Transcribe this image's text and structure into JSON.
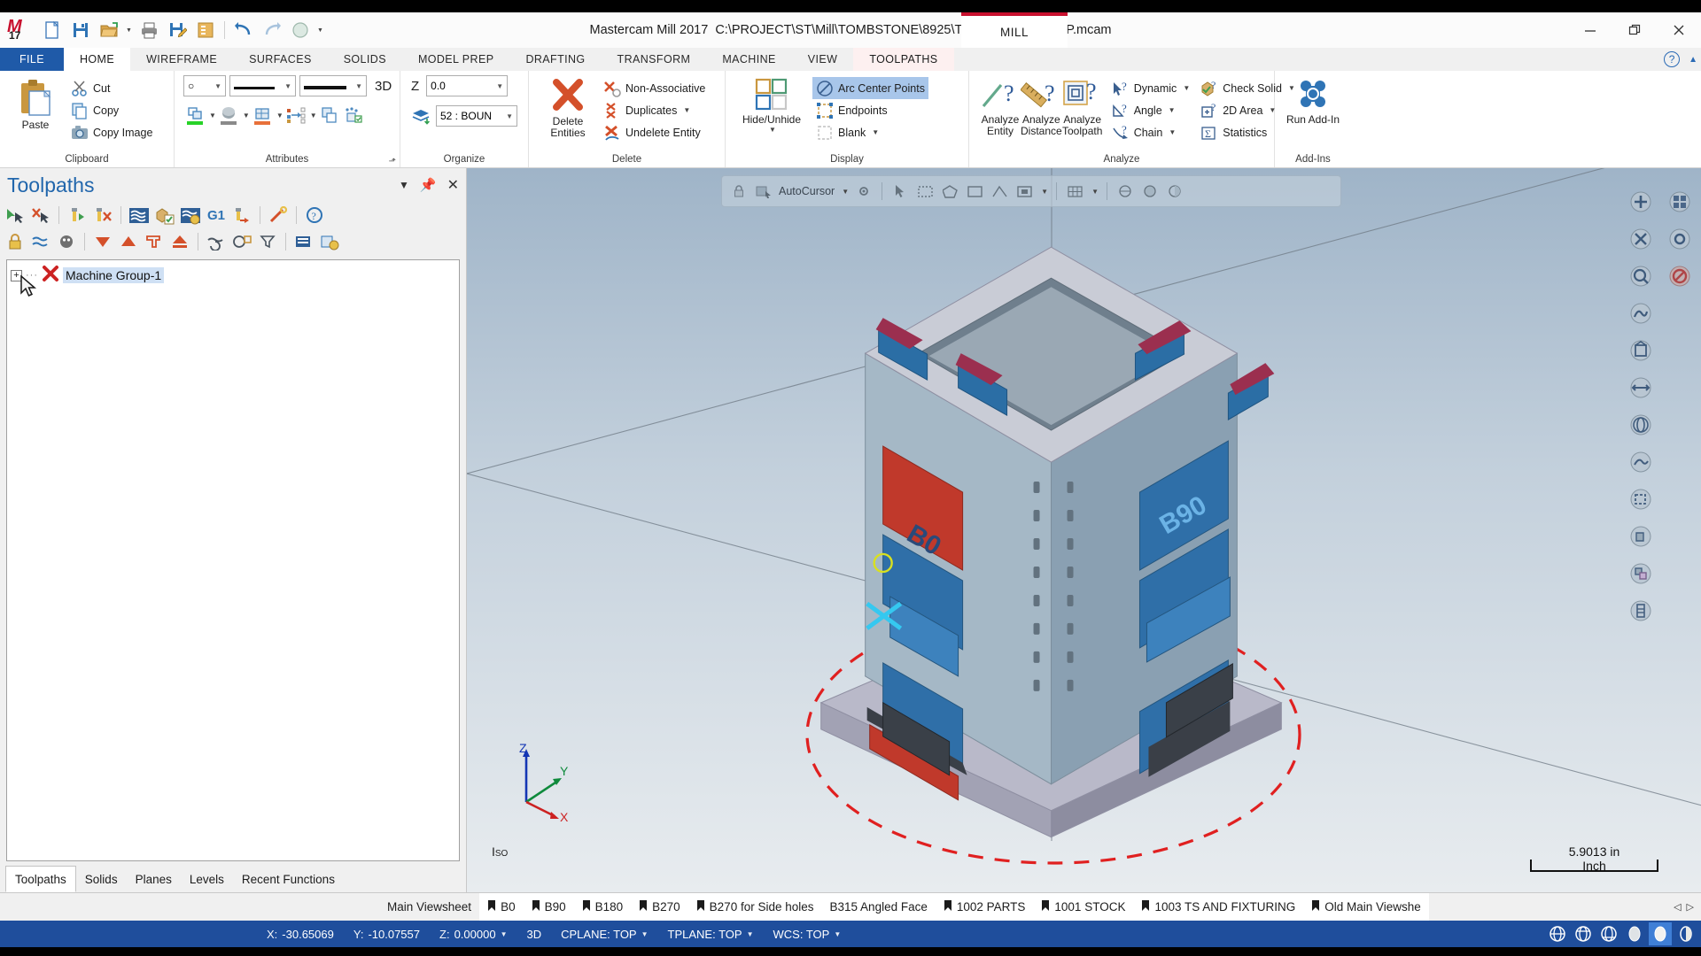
{
  "window": {
    "app_title": "Mastercam Mill 2017",
    "file_path": "C:\\PROJECT\\ST\\Mill\\TOMBSTONE\\8925\\TOMBSTONE TEMP.mcam",
    "machine_tab": "MILL",
    "logo_version": "17",
    "controls": {
      "minimize": "–",
      "restore": "❐",
      "close": "✕"
    }
  },
  "quick_access": [
    {
      "name": "new-file",
      "icon": "new-document-icon"
    },
    {
      "name": "save",
      "icon": "save-icon"
    },
    {
      "name": "open",
      "icon": "open-folder-icon",
      "has_dropdown": true
    },
    {
      "name": "print",
      "icon": "printer-icon"
    },
    {
      "name": "save-as",
      "icon": "save-as-icon"
    },
    {
      "name": "folder",
      "icon": "folder-icon"
    },
    {
      "name": "undo",
      "icon": "undo-icon"
    },
    {
      "name": "redo",
      "icon": "redo-icon"
    },
    {
      "name": "circle",
      "icon": "circle-icon"
    },
    {
      "name": "customize",
      "icon": "chevron-down-icon"
    }
  ],
  "ribbon_tabs": [
    {
      "label": "FILE",
      "state": "file"
    },
    {
      "label": "HOME",
      "state": "active"
    },
    {
      "label": "WIREFRAME",
      "state": "normal"
    },
    {
      "label": "SURFACES",
      "state": "normal"
    },
    {
      "label": "SOLIDS",
      "state": "normal"
    },
    {
      "label": "MODEL PREP",
      "state": "normal"
    },
    {
      "label": "DRAFTING",
      "state": "normal"
    },
    {
      "label": "TRANSFORM",
      "state": "normal"
    },
    {
      "label": "MACHINE",
      "state": "normal"
    },
    {
      "label": "VIEW",
      "state": "normal"
    },
    {
      "label": "TOOLPATHS",
      "state": "tp"
    }
  ],
  "ribbon": {
    "clipboard": {
      "group_label": "Clipboard",
      "paste": "Paste",
      "cut": "Cut",
      "copy": "Copy",
      "copy_image": "Copy Image"
    },
    "attributes": {
      "group_label": "Attributes",
      "point_style": "○",
      "line_style": "—",
      "line_width": "━",
      "depth_mode": "3D"
    },
    "organize": {
      "group_label": "Organize",
      "z_label": "Z",
      "z_value": "0.0",
      "level_value": "52 : BOUN"
    },
    "delete": {
      "group_label": "Delete",
      "delete_entities": "Delete Entities",
      "non_associative": "Non-Associative",
      "duplicates": "Duplicates",
      "undelete_entity": "Undelete Entity"
    },
    "display": {
      "group_label": "Display",
      "hide_unhide": "Hide/Unhide",
      "arc_center_points": "Arc Center Points",
      "endpoints": "Endpoints",
      "blank": "Blank"
    },
    "analyze": {
      "group_label": "Analyze",
      "analyze_entity": "Analyze Entity",
      "analyze_distance": "Analyze Distance",
      "analyze_toolpath": "Analyze Toolpath",
      "dynamic": "Dynamic",
      "angle": "Angle",
      "chain": "Chain",
      "check_solid": "Check Solid",
      "area_2d": "2D Area",
      "statistics": "Statistics"
    },
    "addins": {
      "group_label": "Add-Ins",
      "run_addin": "Run Add-In"
    }
  },
  "toolpaths_panel": {
    "title": "Toolpaths",
    "header_buttons": [
      {
        "name": "panel-dropdown",
        "icon": "chevron-down-icon"
      },
      {
        "name": "panel-pin",
        "icon": "pin-icon"
      },
      {
        "name": "panel-close",
        "icon": "close-icon"
      }
    ],
    "toolbar_row1": [
      "select-all-icon",
      "deselect-all-icon",
      "regen-selected-icon",
      "regen-invalid-icon",
      "toolpath-all-icon",
      "verify-icon",
      "simulate-icon",
      "g1-post-icon",
      "tool-manager-icon",
      "highfeed-icon",
      "help-icon"
    ],
    "toolbar_row2": [
      "lock-icon",
      "toggle-posting-icon",
      "toggle-tool-display-icon",
      "move-down-icon",
      "move-up-icon",
      "insert-icon",
      "move-top-icon",
      "expand-icon",
      "collapse-icon",
      "filter-icon",
      "settings-icon",
      "config-icon"
    ],
    "tree": [
      {
        "label": "Machine Group-1",
        "icon": "red-x-icon",
        "expanded": false,
        "selected": true
      }
    ],
    "bottom_tabs": [
      {
        "label": "Toolpaths",
        "active": true
      },
      {
        "label": "Solids",
        "active": false
      },
      {
        "label": "Planes",
        "active": false
      },
      {
        "label": "Levels",
        "active": false
      },
      {
        "label": "Recent Functions",
        "active": false
      }
    ]
  },
  "viewport": {
    "autocursor_label": "AutoCursor",
    "view_name": "Iso",
    "scale_value": "5.9013 in",
    "scale_unit": "Inch",
    "axis": {
      "x": "X",
      "y": "Y",
      "z": "Z"
    },
    "model_labels": [
      "B0",
      "B90"
    ]
  },
  "sheet_tabs": [
    {
      "label": "Main Viewsheet",
      "active": true,
      "bookmark": false
    },
    {
      "label": "B0",
      "active": false,
      "bookmark": true
    },
    {
      "label": "B90",
      "active": false,
      "bookmark": true
    },
    {
      "label": "B180",
      "active": false,
      "bookmark": true
    },
    {
      "label": "B270",
      "active": false,
      "bookmark": true
    },
    {
      "label": "B270 for  Side holes",
      "active": false,
      "bookmark": true
    },
    {
      "label": "B315 Angled Face",
      "active": false,
      "bookmark": false
    },
    {
      "label": "1002 PARTS",
      "active": false,
      "bookmark": true
    },
    {
      "label": "1001 STOCK",
      "active": false,
      "bookmark": true
    },
    {
      "label": "1003 TS AND FIXTURING",
      "active": false,
      "bookmark": true
    },
    {
      "label": "Old Main Viewshe",
      "active": false,
      "bookmark": true
    }
  ],
  "status_bar": {
    "x_label": "X:",
    "x_value": "-30.65069",
    "y_label": "Y:",
    "y_value": "-10.07557",
    "z_label": "Z:",
    "z_value": "0.00000",
    "mode": "3D",
    "cplane": "CPLANE: TOP",
    "tplane": "TPLANE: TOP",
    "wcs": "WCS: TOP",
    "right_icons": [
      {
        "name": "gview-icon",
        "selected": false
      },
      {
        "name": "cplane-globe-icon",
        "selected": false
      },
      {
        "name": "tplane-globe-icon",
        "selected": false
      },
      {
        "name": "shade-off-icon",
        "selected": false
      },
      {
        "name": "shade-on-icon",
        "selected": true
      },
      {
        "name": "shade-translucent-icon",
        "selected": false
      }
    ]
  },
  "colors": {
    "accent_blue": "#1f5aa8",
    "status_blue": "#1f4e9c",
    "brand_red": "#c8102e",
    "highlight": "#a8c6ea",
    "panel_title": "#2166ac"
  }
}
